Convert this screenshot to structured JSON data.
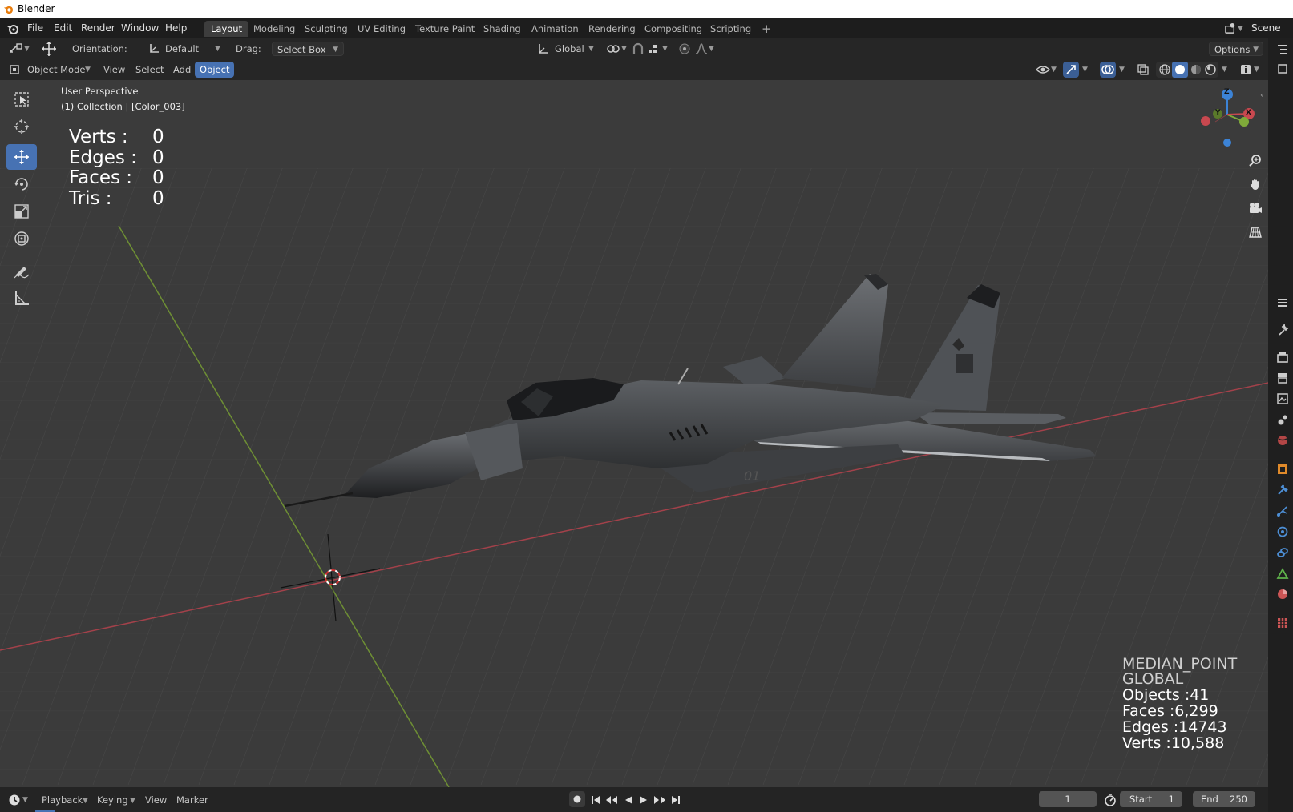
{
  "window": {
    "title": "Blender"
  },
  "menu": [
    "File",
    "Edit",
    "Render",
    "Window",
    "Help"
  ],
  "workspaces": [
    "Layout",
    "Modeling",
    "Sculpting",
    "UV Editing",
    "Texture Paint",
    "Shading",
    "Animation",
    "Rendering",
    "Compositing",
    "Scripting"
  ],
  "active_workspace": "Layout",
  "add_workspace": "+",
  "scene": "Scene",
  "tool_header": {
    "orientation_label": "Orientation:",
    "orientation_value": "Default",
    "drag_label": "Drag:",
    "drag_value": "Select Box",
    "transform_orientation": "Global",
    "options": "Options"
  },
  "viewport_header": {
    "mode": "Object Mode",
    "view": "View",
    "select": "Select",
    "add": "Add",
    "object": "Object"
  },
  "overlay": {
    "perspective": "User Perspective",
    "collection": "(1) Collection | [Color_003]",
    "stats": [
      {
        "label": "Verts :",
        "value": "0"
      },
      {
        "label": "Edges :",
        "value": "0"
      },
      {
        "label": "Faces :",
        "value": "0"
      },
      {
        "label": "Tris :",
        "value": "0"
      }
    ],
    "scene_info": [
      "MEDIAN_POINT",
      "GLOBAL",
      "Objects :41",
      "Faces :6,299",
      "Edges :14743",
      "Verts :10,588"
    ],
    "aircraft_marking": "01"
  },
  "gizmo": {
    "z": "Z",
    "y": "Y",
    "x": "X"
  },
  "timeline": {
    "playback": "Playback",
    "keying": "Keying",
    "view": "View",
    "marker": "Marker",
    "current_frame": "1",
    "start_label": "Start",
    "start_value": "1",
    "end_label": "End",
    "end_value": "250"
  },
  "colors": {
    "accent": "#4772b3",
    "axis_x": "#c8484f",
    "axis_y": "#7faa3a",
    "axis_z": "#3c83d6"
  }
}
